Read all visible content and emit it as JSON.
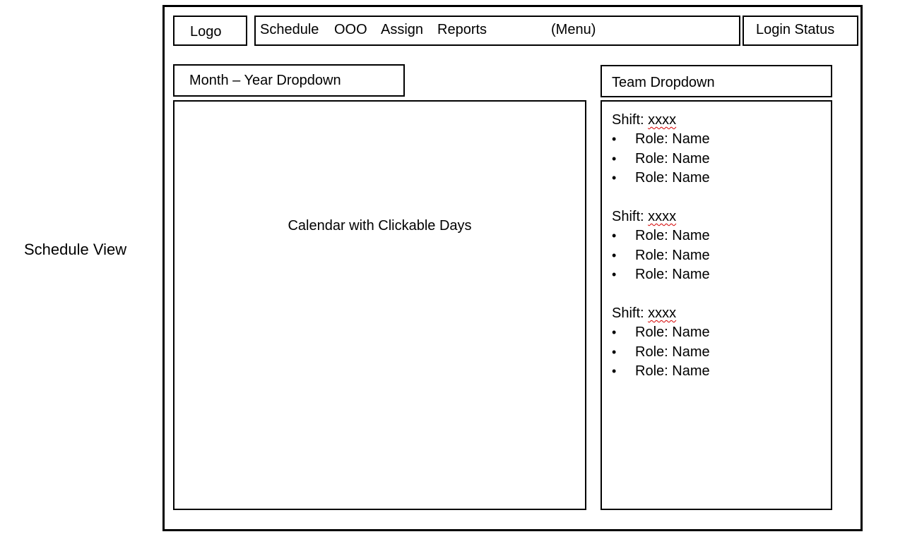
{
  "view_label": "Schedule View",
  "header": {
    "logo": "Logo",
    "menu_items": [
      "Schedule",
      "OOO",
      "Assign",
      "Reports"
    ],
    "menu_note": "(Menu)",
    "login_status": "Login Status"
  },
  "month_year_dropdown": "Month – Year Dropdown",
  "team_dropdown": "Team Dropdown",
  "calendar": {
    "label": "Calendar with Clickable Days"
  },
  "shifts": [
    {
      "prefix": "Shift:",
      "value": "xxxx",
      "roles": [
        "Role: Name",
        "Role: Name",
        "Role: Name"
      ]
    },
    {
      "prefix": "Shift:",
      "value": "xxxx",
      "roles": [
        "Role: Name",
        "Role: Name",
        "Role: Name"
      ]
    },
    {
      "prefix": "Shift:",
      "value": "xxxx",
      "roles": [
        "Role: Name",
        "Role: Name",
        "Role: Name"
      ]
    }
  ],
  "bullet_glyph": "•",
  "colors": {
    "border": "#000000",
    "spellcheck_underline": "#d40000"
  }
}
